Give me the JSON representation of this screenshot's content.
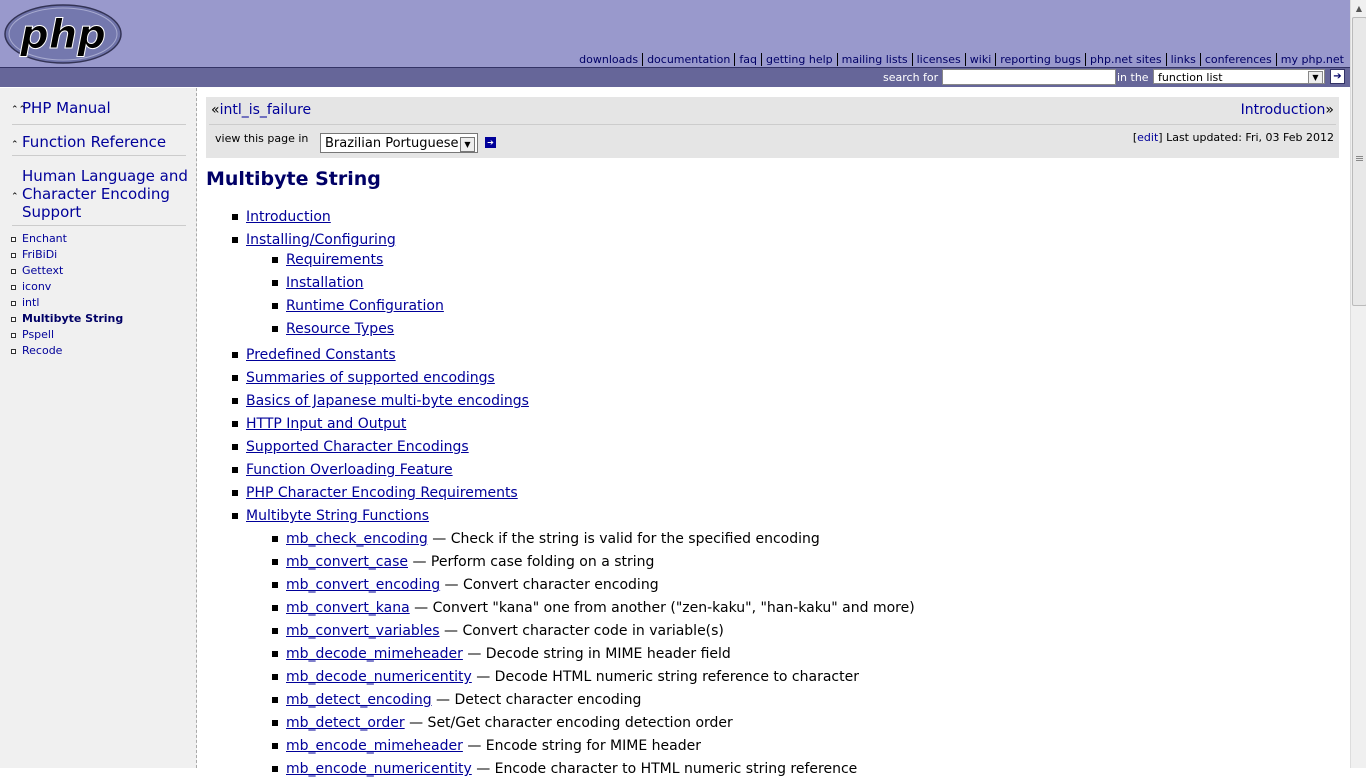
{
  "logo": {
    "text": "php"
  },
  "topnav": [
    "downloads",
    "documentation",
    "faq",
    "getting help",
    "mailing lists",
    "licenses",
    "wiki",
    "reporting bugs",
    "php.net sites",
    "links",
    "conferences",
    "my php.net"
  ],
  "search": {
    "label": "search for",
    "value": "",
    "in_label": "in the",
    "scope": "function list",
    "go_icon": "arrow-right-icon"
  },
  "sidebar": {
    "manual": "PHP Manual",
    "function_reference": "Function Reference",
    "section": "Human Language and Character Encoding Support",
    "items": [
      {
        "label": "Enchant"
      },
      {
        "label": "FriBiDi"
      },
      {
        "label": "Gettext"
      },
      {
        "label": "iconv"
      },
      {
        "label": "intl"
      },
      {
        "label": "Multibyte String",
        "active": true
      },
      {
        "label": "Pspell"
      },
      {
        "label": "Recode"
      }
    ]
  },
  "pagenav": {
    "prev": "intl_is_failure",
    "next": "Introduction",
    "view_label": "view this page in",
    "language": "Brazilian Portuguese",
    "edit": "edit",
    "updated": "Last updated: Fri, 03 Feb 2012"
  },
  "page_title": "Multibyte String",
  "toc": {
    "introduction": "Introduction",
    "installing": "Installing/Configuring",
    "installing_sub": [
      "Requirements",
      "Installation",
      "Runtime Configuration",
      "Resource Types"
    ],
    "sections": [
      "Predefined Constants",
      "Summaries of supported encodings",
      "Basics of Japanese multi-byte encodings",
      "HTTP Input and Output",
      "Supported Character Encodings",
      "Function Overloading Feature",
      "PHP Character Encoding Requirements"
    ],
    "functions_title": "Multibyte String Functions",
    "functions": [
      {
        "name": "mb_check_encoding",
        "desc": " — Check if the string is valid for the specified encoding"
      },
      {
        "name": "mb_convert_case",
        "desc": " — Perform case folding on a string"
      },
      {
        "name": "mb_convert_encoding",
        "desc": " — Convert character encoding"
      },
      {
        "name": "mb_convert_kana",
        "desc": " — Convert \"kana\" one from another (\"zen-kaku\", \"han-kaku\" and more)"
      },
      {
        "name": "mb_convert_variables",
        "desc": " — Convert character code in variable(s)"
      },
      {
        "name": "mb_decode_mimeheader",
        "desc": " — Decode string in MIME header field"
      },
      {
        "name": "mb_decode_numericentity",
        "desc": " — Decode HTML numeric string reference to character"
      },
      {
        "name": "mb_detect_encoding",
        "desc": " — Detect character encoding"
      },
      {
        "name": "mb_detect_order",
        "desc": " — Set/Get character encoding detection order"
      },
      {
        "name": "mb_encode_mimeheader",
        "desc": " — Encode string for MIME header"
      },
      {
        "name": "mb_encode_numericentity",
        "desc": " — Encode character to HTML numeric string reference"
      }
    ]
  }
}
